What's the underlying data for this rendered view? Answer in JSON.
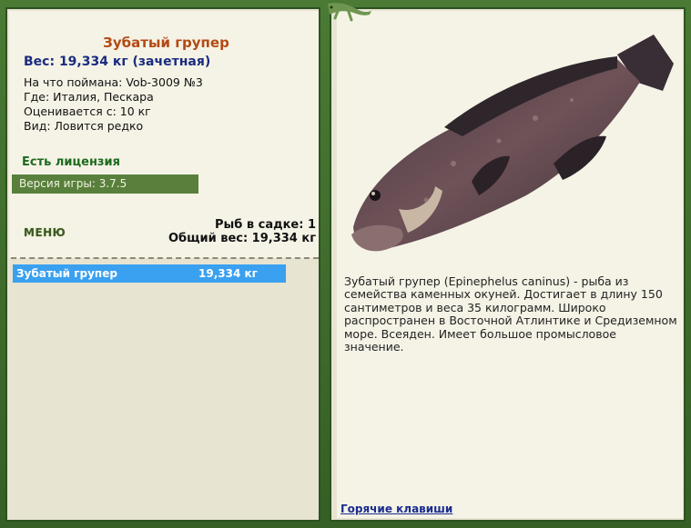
{
  "fish": {
    "name": "Зубатый групер",
    "weight_line": "Вес: 19,334 кг (зачетная)",
    "bait": "На что поймана: Vob-3009 №3",
    "location": "Где: Италия, Пескара",
    "rated_from": "Оценивается с: 10 кг",
    "type": "Вид: Ловится редко"
  },
  "license": "Есть лицензия",
  "version": "Версия игры: 3.7.5",
  "menu_label": "МЕНЮ",
  "cage": {
    "count_line": "Рыб в садке: 1",
    "total_line": "Общий вес: 19,334 кг"
  },
  "catch_list": [
    {
      "name": "Зубатый групер",
      "weight": "19,334 кг"
    }
  ],
  "description": "Зубатый групер (Epinephelus caninus) - рыба из семейства каменных окуней. Достигает в длину 150 сантиметров и веса 35 килограмм. Широко распространен в Восточной Атлинтике и Средиземном море. Всеяден. Имеет большое промысловое значение.",
  "hotkeys_label": "Горячие клавиши"
}
